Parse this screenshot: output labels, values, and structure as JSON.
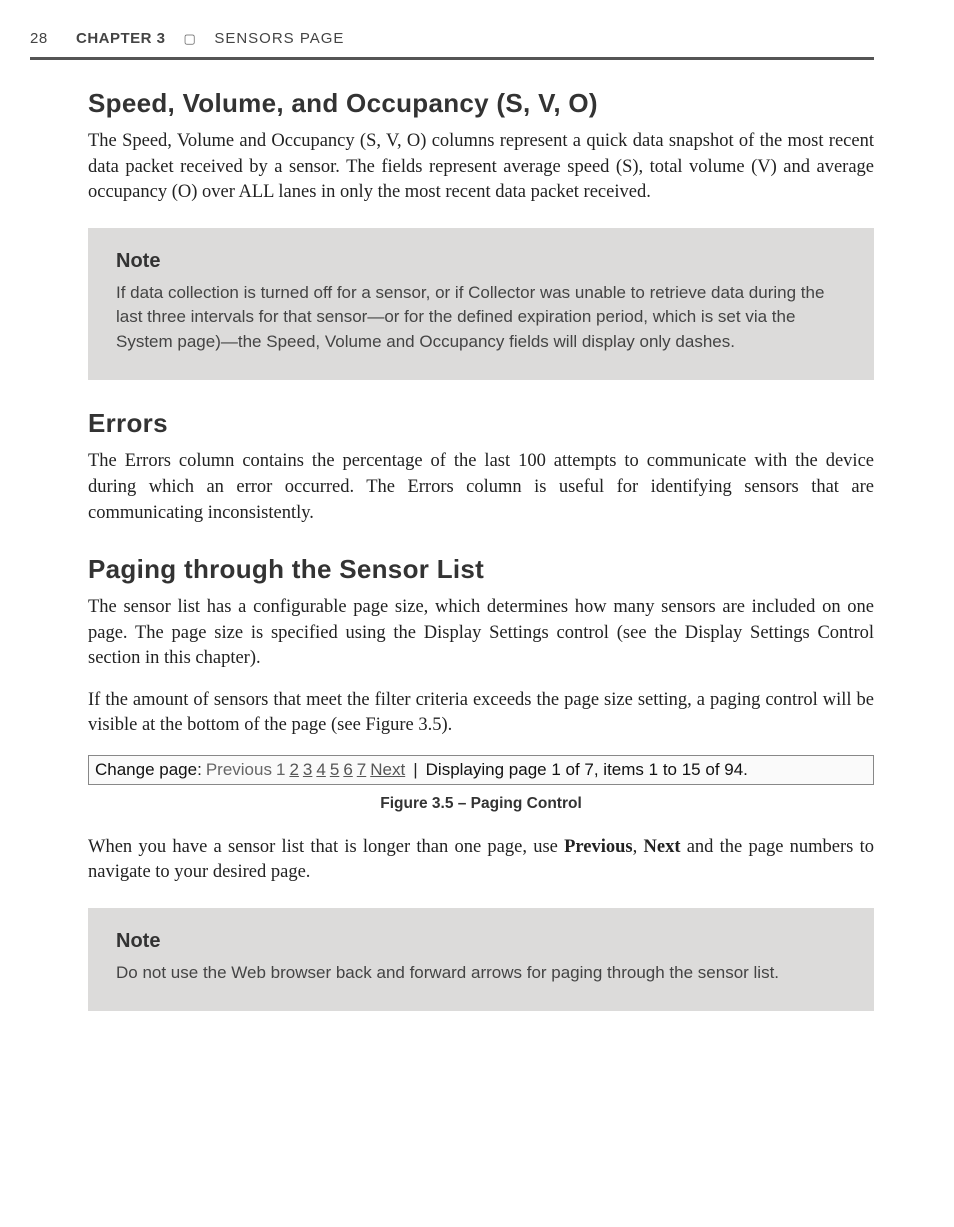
{
  "header": {
    "page_number": "28",
    "chapter_label": "CHAPTER 3",
    "square": "▢",
    "section_title": "SENSORS PAGE"
  },
  "sections": {
    "svo": {
      "heading": "Speed, Volume, and Occupancy (S, V, O)",
      "p1": "The Speed, Volume and Occupancy (S, V, O) columns represent a quick data snapshot of the most recent data packet received by a sensor. The fields represent average speed (S), total volume (V) and average occupancy (O) over ALL lanes in only the most recent data packet received."
    },
    "note1": {
      "heading": "Note",
      "body": "If data collection is turned off for a sensor, or if Collector was unable to retrieve data during the last three intervals for that sensor—or for the defined expiration period, which is set via the System page)—the Speed, Volume and Occupancy fields will display only dashes."
    },
    "errors": {
      "heading": "Errors",
      "p1": "The Errors column contains the percentage of the last 100 attempts to communicate with the device during which an error occurred. The Errors column is useful for identifying sensors that are communicating inconsistently."
    },
    "paging": {
      "heading": "Paging through the Sensor List",
      "p1": "The sensor list has a configurable page size, which determines how many sensors are included on one page. The page size is specified using the Display Settings control (see the Display Settings Control section in this chapter).",
      "p2": "If the amount of sensors that meet the filter criteria exceeds the page size setting, a paging control will be visible at the bottom of the page (see Figure 3.5).",
      "p3_pre": "When you have a sensor list that is longer than one page, use ",
      "p3_b1": "Previous",
      "p3_mid": ", ",
      "p3_b2": "Next",
      "p3_post": " and the page numbers to navigate to your desired page."
    },
    "figure": {
      "change_page_label": "Change page:",
      "previous": "Previous",
      "current": "1",
      "links": [
        "2",
        "3",
        "4",
        "5",
        "6",
        "7"
      ],
      "next": "Next",
      "sep": "|",
      "display_text": "Displaying page 1 of 7, items 1 to 15 of 94.",
      "caption": "Figure 3.5 – Paging Control"
    },
    "note2": {
      "heading": "Note",
      "body": "Do not use the Web browser back and forward arrows for paging through the sensor list."
    }
  }
}
